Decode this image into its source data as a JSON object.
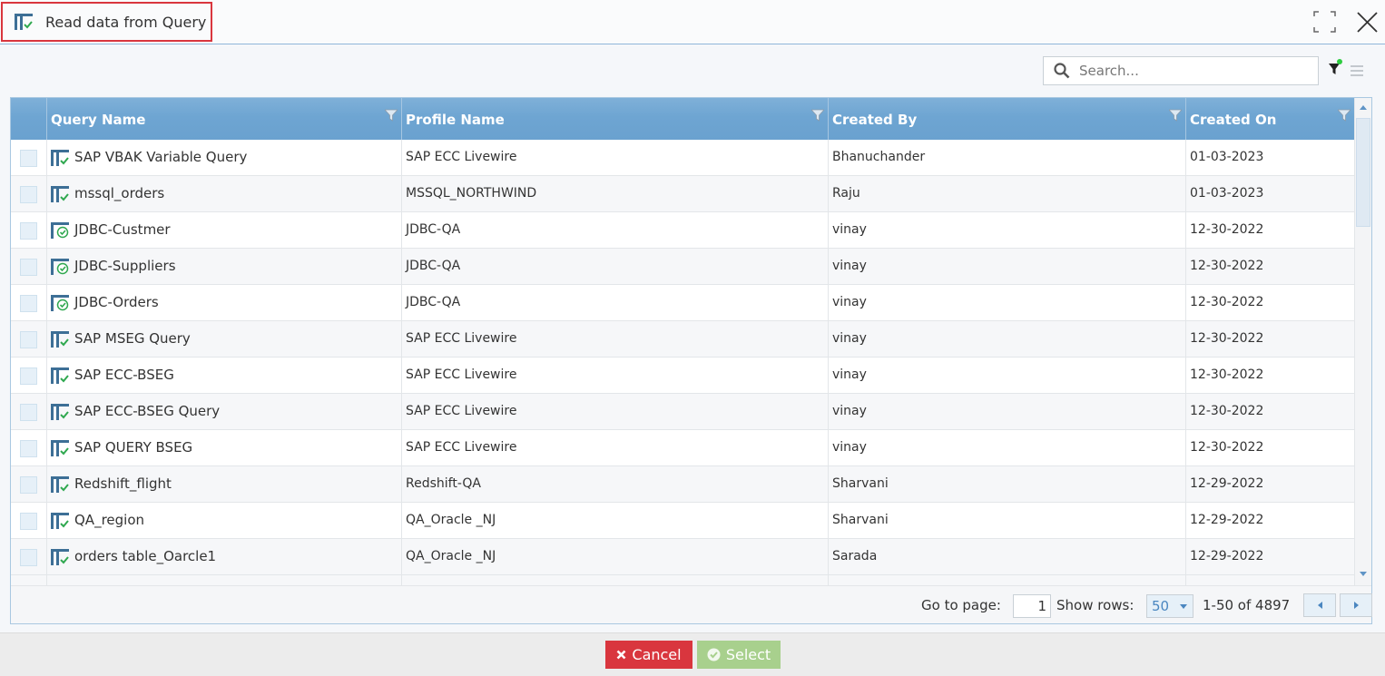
{
  "window": {
    "title": "Read data from Query"
  },
  "search": {
    "placeholder": "Search..."
  },
  "colors": {
    "header": "#6ea5d2",
    "cancel": "#d9363e",
    "select": "#a8d08d",
    "filter_active_dot": "#2ecc40"
  },
  "table": {
    "columns": [
      "Query Name",
      "Profile Name",
      "Created By",
      "Created On"
    ],
    "rows": [
      {
        "icon": "sap-query-icon",
        "name": "SAP VBAK Variable Query",
        "profile": "SAP ECC Livewire",
        "created_by": "Bhanuchander",
        "created_on": "01-03-2023"
      },
      {
        "icon": "sap-query-icon",
        "name": "mssql_orders",
        "profile": "MSSQL_NORTHWIND",
        "created_by": "Raju",
        "created_on": "01-03-2023"
      },
      {
        "icon": "jdbc-query-icon",
        "name": "JDBC-Custmer",
        "profile": "JDBC-QA",
        "created_by": "vinay",
        "created_on": "12-30-2022"
      },
      {
        "icon": "jdbc-query-icon",
        "name": "JDBC-Suppliers",
        "profile": "JDBC-QA",
        "created_by": "vinay",
        "created_on": "12-30-2022"
      },
      {
        "icon": "jdbc-query-icon",
        "name": "JDBC-Orders",
        "profile": "JDBC-QA",
        "created_by": "vinay",
        "created_on": "12-30-2022"
      },
      {
        "icon": "sap-query-icon",
        "name": "SAP MSEG Query",
        "profile": "SAP ECC Livewire",
        "created_by": "vinay",
        "created_on": "12-30-2022"
      },
      {
        "icon": "sap-query-icon",
        "name": "SAP ECC-BSEG",
        "profile": "SAP ECC Livewire",
        "created_by": "vinay",
        "created_on": "12-30-2022"
      },
      {
        "icon": "sap-query-icon",
        "name": "SAP ECC-BSEG Query",
        "profile": "SAP ECC Livewire",
        "created_by": "vinay",
        "created_on": "12-30-2022"
      },
      {
        "icon": "sap-query-icon",
        "name": "SAP QUERY BSEG",
        "profile": "SAP ECC Livewire",
        "created_by": "vinay",
        "created_on": "12-30-2022"
      },
      {
        "icon": "sap-query-icon",
        "name": "Redshift_flight",
        "profile": "Redshift-QA",
        "created_by": "Sharvani",
        "created_on": "12-29-2022"
      },
      {
        "icon": "sap-query-icon",
        "name": "QA_region",
        "profile": "QA_Oracle _NJ",
        "created_by": "Sharvani",
        "created_on": "12-29-2022"
      },
      {
        "icon": "sap-query-icon",
        "name": "orders table_Oarcle1",
        "profile": "QA_Oracle _NJ",
        "created_by": "Sarada",
        "created_on": "12-29-2022"
      }
    ]
  },
  "pager": {
    "goto_label": "Go to page:",
    "page": "1",
    "show_rows_label": "Show rows:",
    "rows_per_page": "50",
    "range_text": "1-50 of 4897"
  },
  "buttons": {
    "cancel": "Cancel",
    "select": "Select"
  }
}
